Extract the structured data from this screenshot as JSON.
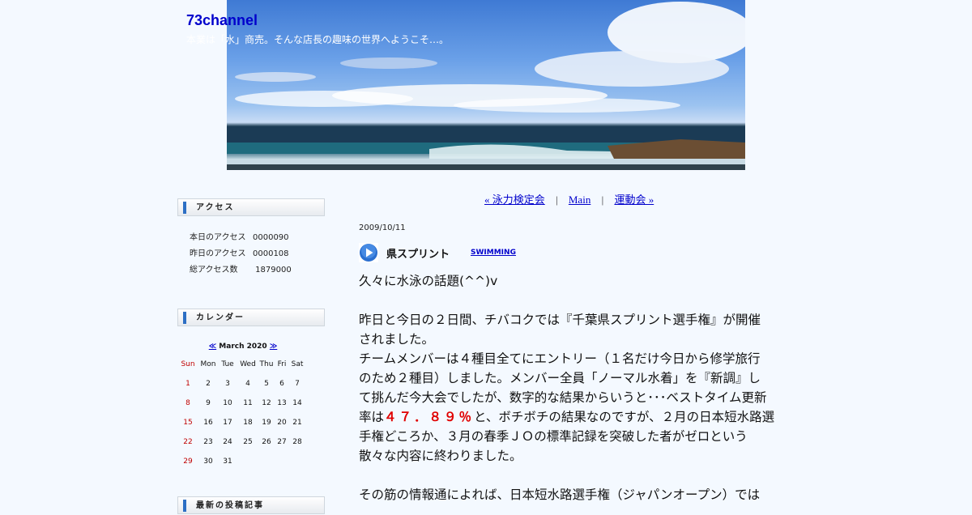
{
  "header": {
    "title": "73channel",
    "subtitle": "本業は「水」商売。そんな店長の趣味の世界へようこそ…。"
  },
  "sidebar": {
    "access": {
      "heading": "アクセス",
      "rows": [
        {
          "label": "本日のアクセス",
          "value": "0000090"
        },
        {
          "label": "昨日のアクセス",
          "value": "0000108"
        },
        {
          "label": "総アクセス数",
          "value": " 1879000"
        }
      ]
    },
    "calendar": {
      "heading": "カレンダー",
      "prev": "≪",
      "month": "March 2020",
      "next": "≫",
      "weekdays": [
        "Sun",
        "Mon",
        "Tue",
        "Wed",
        "Thu",
        "Fri",
        "Sat"
      ],
      "days": [
        "1",
        "2",
        "3",
        "4",
        "5",
        "6",
        "7",
        "8",
        "9",
        "10",
        "11",
        "12",
        "13",
        "14",
        "15",
        "16",
        "17",
        "18",
        "19",
        "20",
        "21",
        "22",
        "23",
        "24",
        "25",
        "26",
        "27",
        "28",
        "29",
        "30",
        "31"
      ]
    },
    "recent": {
      "heading": "最新の投稿記事"
    }
  },
  "nav": {
    "prev": "« 泳力検定会",
    "main": "Main",
    "next": "運動会 »",
    "sep": "|"
  },
  "post": {
    "date": "2009/10/11",
    "title": "県スプリント",
    "category": "SWIMMING",
    "lines": [
      "久々に水泳の話題(^^)v",
      "",
      "昨日と今日の２日間、チバコクでは『千葉県スプリント選手権』が開催",
      "されました。",
      "チームメンバーは４種目全てにエントリー（１名だけ今日から修学旅行",
      "のため２種目）しました。メンバー全員「ノーマル水着」を『新調』し",
      "て挑んだ今大会でしたが、数字的な結果からいうと･･･ベストタイム更新"
    ],
    "rate_prefix": "率は",
    "rate_value": "４７．８９％",
    "rate_suffix": "と、ボチボチの結果なのですが、２月の日本短水路選",
    "lines2": [
      "手権どころか、３月の春季ＪＯの標準記録を突破した者がゼロという",
      "散々な内容に終わりました。",
      "",
      "その筋の情報通によれば、日本短水路選手権（ジャパンオープン）では"
    ]
  },
  "colors": {
    "link": "#0000cc",
    "highlight": "#e00000",
    "accent": "#2d6fc4"
  },
  "icons": {
    "post": "play-icon"
  }
}
